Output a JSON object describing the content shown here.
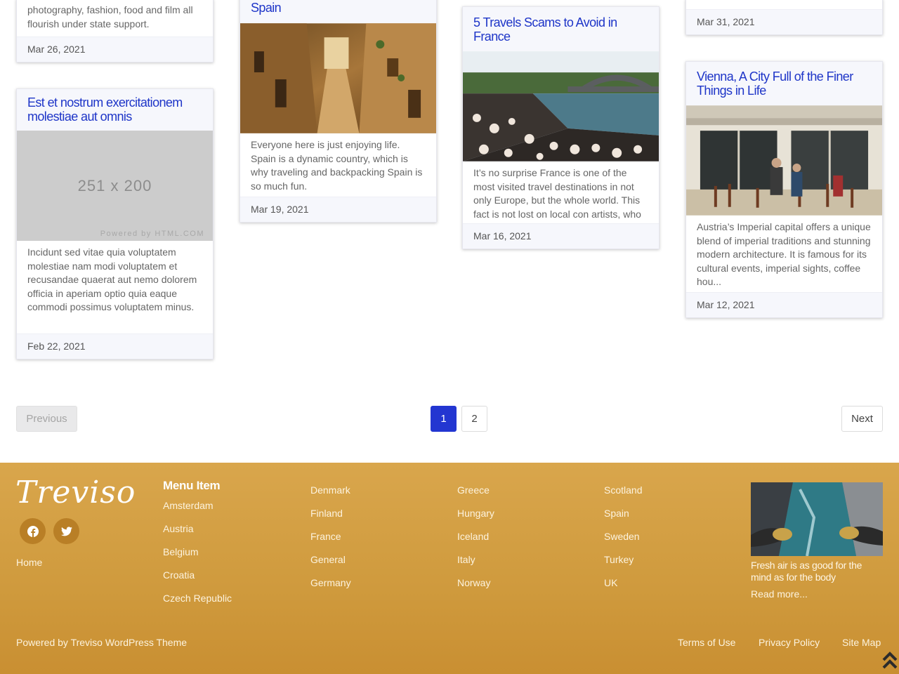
{
  "cards": [
    {
      "id": "c1",
      "title": "",
      "excerpt_tail": "photography, fashion, food and film all flourish under state support.",
      "date": "Mar 26, 2021"
    },
    {
      "id": "c2",
      "title": "Est et nostrum exercitationem molestiae aut omnis",
      "image_placeholder": "251 x 200",
      "image_watermark": "Powered by HTML.COM",
      "excerpt": "Incidunt sed vitae quia voluptatem molestiae nam modi voluptatem et recusandae quaerat aut nemo dolorem officia in aperiam optio quia eaque commodi possimus voluptatem minus.",
      "date": "Feb 22, 2021"
    },
    {
      "id": "c3",
      "title_tail": "Spain",
      "excerpt": "Everyone here is just enjoying life. Spain is a dynamic country, which is why traveling and backpacking Spain is so much fun.",
      "date": "Mar 19, 2021"
    },
    {
      "id": "c4",
      "title": "5 Travels Scams to Avoid in France",
      "excerpt": "It’s no surprise France is one of the most visited travel destinations in not only Europe, but the whole world. This fact is not lost on local con artists, who have c...",
      "date": "Mar 16, 2021"
    },
    {
      "id": "c5",
      "date": "Mar 31, 2021"
    },
    {
      "id": "c6",
      "title": "Vienna, A City Full of the Finer Things in Life",
      "excerpt": "Austria’s Imperial capital offers a unique blend of imperial traditions and stunning modern architecture. It is famous for its cultural events, imperial sights, coffee hou...",
      "date": "Mar 12, 2021"
    }
  ],
  "pagination": {
    "previous": "Previous",
    "next": "Next",
    "pages": [
      "1",
      "2"
    ],
    "current": "1"
  },
  "footer": {
    "brand": "Treviso",
    "social_icons": [
      "facebook-icon",
      "twitter-icon"
    ],
    "home": "Home",
    "menu_heading": "Menu Item",
    "menu_columns": [
      [
        "Amsterdam",
        "Austria",
        "Belgium",
        "Croatia",
        "Czech Republic"
      ],
      [
        "Denmark",
        "Finland",
        "France",
        "General",
        "Germany"
      ],
      [
        "Greece",
        "Hungary",
        "Iceland",
        "Italy",
        "Norway"
      ],
      [
        "Scotland",
        "Spain",
        "Sweden",
        "Turkey",
        "UK"
      ]
    ],
    "promo_caption": "Fresh air is as good for the mind as for the body",
    "promo_more": "Read more...",
    "powered_by": "Powered by Treviso WordPress Theme",
    "bottom_links": [
      "Terms of Use",
      "Privacy Policy",
      "Site Map"
    ],
    "to_top_icon": "double-chevron-up-icon"
  },
  "colors": {
    "title_blue": "#1e35c8",
    "pagination_active": "#2336d1",
    "footer_gold": "#d4a045"
  }
}
